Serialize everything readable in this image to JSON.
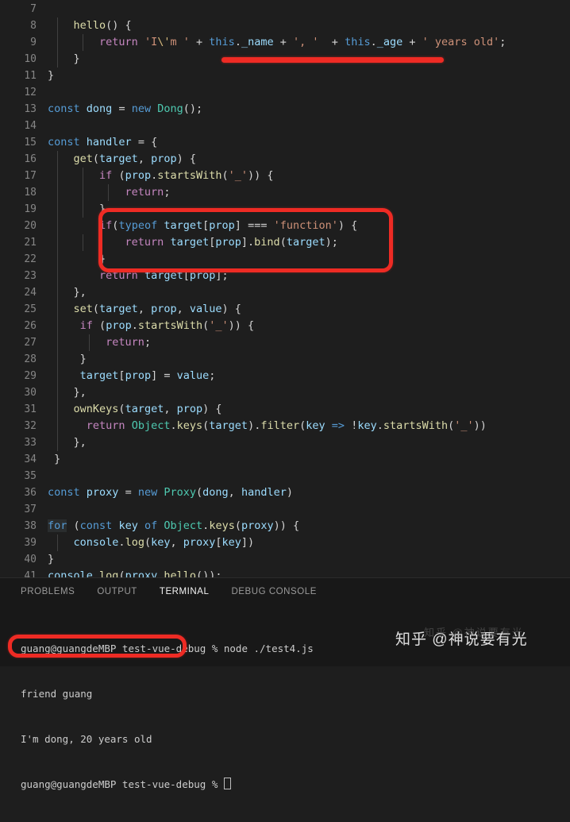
{
  "editor": {
    "first_line_number": 7,
    "background": "#1e1e1e",
    "lines": [
      {
        "n": "7",
        "text": ""
      },
      {
        "n": "8",
        "text": "    hello() {"
      },
      {
        "n": "9",
        "text": "        return 'I\\'m ' + this._name + ', '  + this._age + ' years old';"
      },
      {
        "n": "10",
        "text": "    }"
      },
      {
        "n": "11",
        "text": "}"
      },
      {
        "n": "12",
        "text": ""
      },
      {
        "n": "13",
        "text": "const dong = new Dong();"
      },
      {
        "n": "14",
        "text": ""
      },
      {
        "n": "15",
        "text": "const handler = {"
      },
      {
        "n": "16",
        "text": "    get(target, prop) {"
      },
      {
        "n": "17",
        "text": "        if (prop.startsWith('_')) {"
      },
      {
        "n": "18",
        "text": "            return;"
      },
      {
        "n": "19",
        "text": "        }"
      },
      {
        "n": "20",
        "text": "        if(typeof target[prop] === 'function') {"
      },
      {
        "n": "21",
        "text": "            return target[prop].bind(target);"
      },
      {
        "n": "22",
        "text": "        }"
      },
      {
        "n": "23",
        "text": "        return target[prop];"
      },
      {
        "n": "24",
        "text": "    },"
      },
      {
        "n": "25",
        "text": "    set(target, prop, value) {"
      },
      {
        "n": "26",
        "text": "     if (prop.startsWith('_')) {"
      },
      {
        "n": "27",
        "text": "         return;"
      },
      {
        "n": "28",
        "text": "     }"
      },
      {
        "n": "29",
        "text": "     target[prop] = value;"
      },
      {
        "n": "30",
        "text": "    },"
      },
      {
        "n": "31",
        "text": "    ownKeys(target, prop) {"
      },
      {
        "n": "32",
        "text": "      return Object.keys(target).filter(key => !key.startsWith('_'))"
      },
      {
        "n": "33",
        "text": "    },"
      },
      {
        "n": "34",
        "text": " }"
      },
      {
        "n": "35",
        "text": ""
      },
      {
        "n": "36",
        "text": "const proxy = new Proxy(dong, handler)"
      },
      {
        "n": "37",
        "text": ""
      },
      {
        "n": "38",
        "text": "for (const key of Object.keys(proxy)) {"
      },
      {
        "n": "39",
        "text": "    console.log(key, proxy[key])"
      },
      {
        "n": "40",
        "text": "}"
      },
      {
        "n": "41",
        "text": "console.log(proxy.hello());"
      }
    ]
  },
  "annotations": {
    "color": "#ee2b24",
    "underline_line10_label": "red-underline-under-hello-method",
    "box_lines20_22_label": "red-box-around-function-bind-block",
    "box_terminal_label": "red-box-around-hello-output"
  },
  "panel": {
    "tabs": [
      {
        "label": "PROBLEMS",
        "active": false
      },
      {
        "label": "OUTPUT",
        "active": false
      },
      {
        "label": "TERMINAL",
        "active": true
      },
      {
        "label": "DEBUG CONSOLE",
        "active": false
      }
    ],
    "terminal_lines": [
      "guang@guangdeMBP test-vue-debug % node ./test4.js",
      "friend guang",
      "I'm dong, 20 years old",
      "guang@guangdeMBP test-vue-debug % "
    ],
    "prompt_user_host": "guang@guangdeMBP",
    "prompt_cwd": "test-vue-debug",
    "prompt_symbol": "%",
    "command": "node ./test4.js"
  },
  "watermark": {
    "text": "知乎 @神说要有光",
    "ghost": "知乎 @神说要有光"
  }
}
